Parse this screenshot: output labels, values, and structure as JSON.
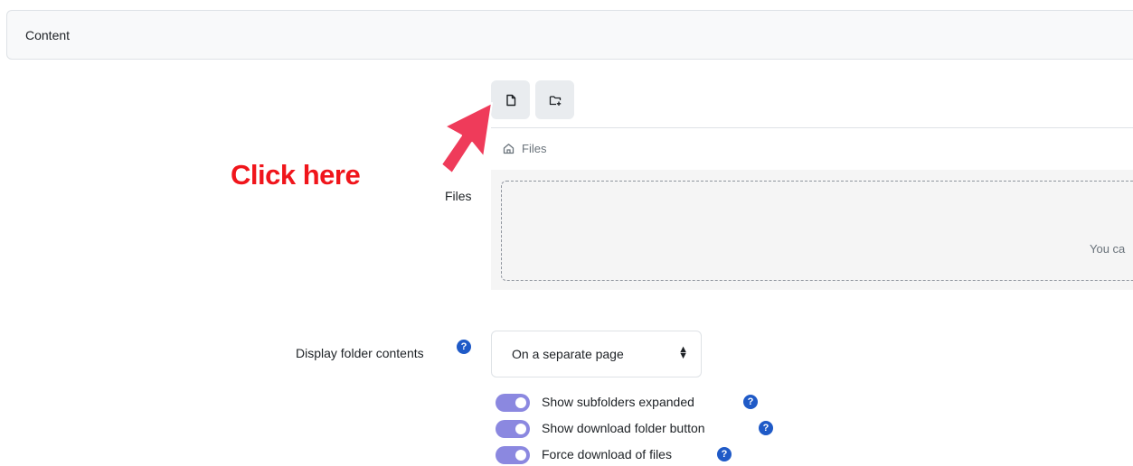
{
  "section": {
    "title": "Content"
  },
  "toolbar": {
    "add_file_icon": "file-icon",
    "create_folder_icon": "folder-plus-icon"
  },
  "filemanager": {
    "path_label": "Files",
    "field_label": "Files",
    "dropzone_text": "You ca"
  },
  "display": {
    "label": "Display folder contents",
    "help": "?",
    "selected": "On a separate page",
    "caret": "⬍"
  },
  "options": [
    {
      "label": "Show subfolders expanded",
      "help": "?"
    },
    {
      "label": "Show download folder button",
      "help": "?"
    },
    {
      "label": "Force download of files",
      "help": "?"
    }
  ],
  "annotation": {
    "text": "Click here",
    "color": "#f0151b",
    "arrow_color": "#ef3b5a"
  },
  "colors": {
    "toggle_on": "#8b88e0",
    "help_icon": "#1f5ac7"
  }
}
